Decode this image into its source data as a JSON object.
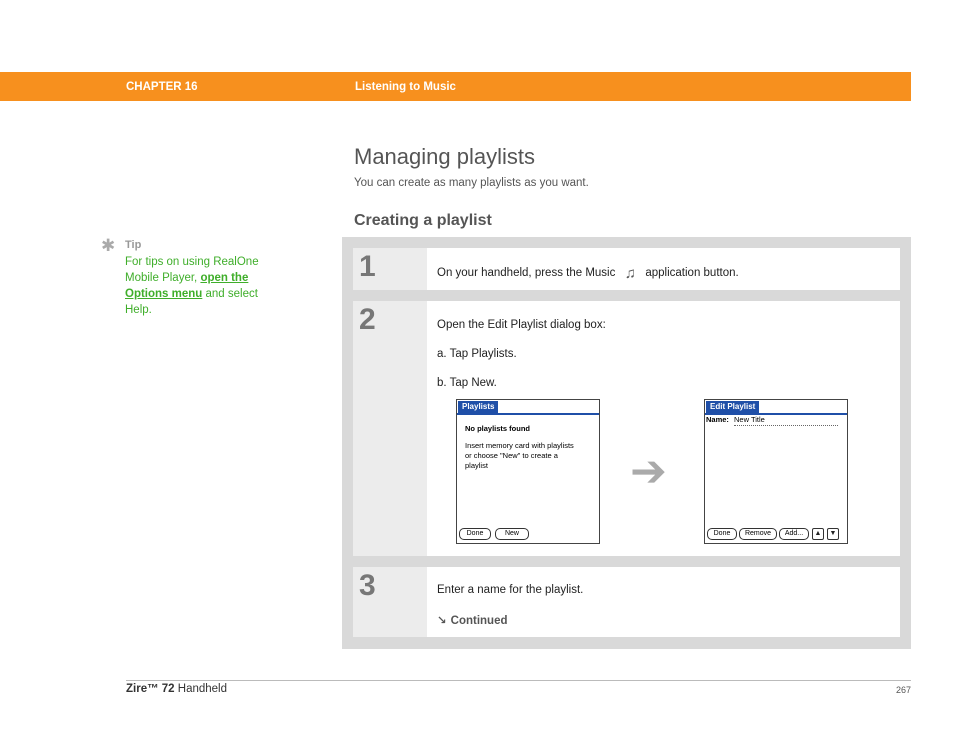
{
  "header": {
    "chapter": "CHAPTER 16",
    "chapter_title": "Listening to Music"
  },
  "title": "Managing playlists",
  "subtitle": "You can create as many playlists as you want.",
  "section_title": "Creating a playlist",
  "tip": {
    "label": "Tip",
    "text_before": "For tips on using RealOne Mobile Player, ",
    "link_text": "open the Options menu",
    "text_after": " and select Help."
  },
  "steps": [
    {
      "number": "1",
      "text_before": "On your handheld, press the Music",
      "icon": "music-note-icon",
      "text_after": "application button."
    },
    {
      "number": "2",
      "intro": "Open the Edit Playlist dialog box:",
      "sub_a": "a.  Tap Playlists.",
      "sub_b": "b.  Tap New."
    },
    {
      "number": "3",
      "text": "Enter a name for the playlist.",
      "continued": "Continued"
    }
  ],
  "screens": {
    "left": {
      "title": "Playlists",
      "heading": "No playlists found",
      "body": "Insert memory card with playlists or choose \"New\" to create a playlist",
      "buttons": [
        "Done",
        "New"
      ]
    },
    "right": {
      "title": "Edit Playlist",
      "name_label": "Name:",
      "name_value": "New Title",
      "buttons": [
        "Done",
        "Remove",
        "Add..."
      ]
    }
  },
  "footer": {
    "product": "Zire™ 72",
    "product_suffix": " Handheld",
    "page": "267"
  },
  "colors": {
    "accent": "#f7901e",
    "tip_green": "#3fae2a",
    "palm_blue": "#1f4fa8"
  }
}
